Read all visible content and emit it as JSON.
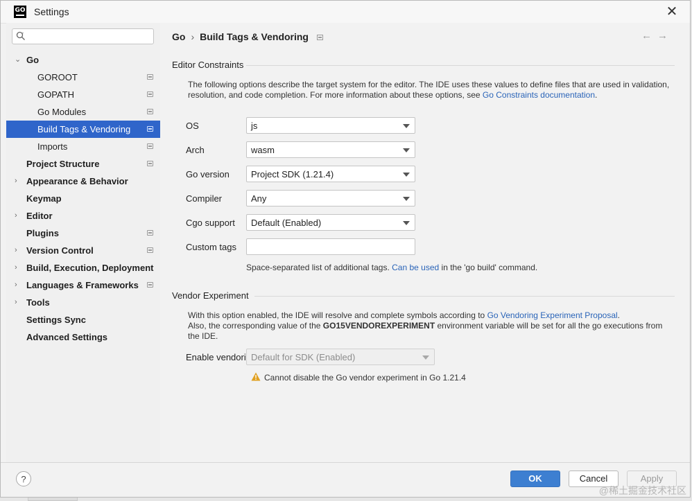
{
  "window": {
    "title": "Settings",
    "app_icon_text": "GO"
  },
  "sidebar": {
    "search_placeholder": "",
    "items": [
      {
        "label": "Go"
      },
      {
        "label": "GOROOT"
      },
      {
        "label": "GOPATH"
      },
      {
        "label": "Go Modules"
      },
      {
        "label": "Build Tags & Vendoring"
      },
      {
        "label": "Imports"
      },
      {
        "label": "Project Structure"
      },
      {
        "label": "Appearance & Behavior"
      },
      {
        "label": "Keymap"
      },
      {
        "label": "Editor"
      },
      {
        "label": "Plugins"
      },
      {
        "label": "Version Control"
      },
      {
        "label": "Build, Execution, Deployment"
      },
      {
        "label": "Languages & Frameworks"
      },
      {
        "label": "Tools"
      },
      {
        "label": "Settings Sync"
      },
      {
        "label": "Advanced Settings"
      }
    ]
  },
  "breadcrumb": {
    "parent": "Go",
    "separator": "›",
    "current": "Build Tags & Vendoring"
  },
  "nav": {
    "back": "←",
    "forward": "→"
  },
  "editor_constraints": {
    "title": "Editor Constraints",
    "desc_text": "The following options describe the target system for the editor. The IDE uses these values to define files that are used in validation, resolution, and code completion. For more information about these options, see ",
    "desc_link": "Go Constraints documentation",
    "desc_end": ".",
    "fields": {
      "os": {
        "label": "OS",
        "value": "js"
      },
      "arch": {
        "label": "Arch",
        "value": "wasm"
      },
      "go_version": {
        "label": "Go version",
        "value": "Project SDK (1.21.4)"
      },
      "compiler": {
        "label": "Compiler",
        "value": "Any"
      },
      "cgo": {
        "label": "Cgo support",
        "value": "Default (Enabled)"
      },
      "custom_tags": {
        "label": "Custom tags",
        "value": ""
      }
    },
    "hint_text": "Space-separated list of additional tags. ",
    "hint_link": "Can be used",
    "hint_end": " in the 'go build' command."
  },
  "vendor": {
    "title": "Vendor Experiment",
    "desc1_text": "With this option enabled, the IDE will resolve and complete symbols according to ",
    "desc1_link": "Go Vendoring Experiment Proposal",
    "desc1_end": ".",
    "desc2_start": "Also, the corresponding value of the ",
    "desc2_bold": "GO15VENDOREXPERIMENT",
    "desc2_end": " environment variable will be set for all the go executions from the IDE.",
    "enable_label": "Enable vendoring",
    "enable_value": "Default for SDK (Enabled)",
    "warning": "Cannot disable the Go vendor experiment in Go 1.21.4"
  },
  "footer": {
    "help": "?",
    "ok": "OK",
    "cancel": "Cancel",
    "apply": "Apply"
  },
  "watermark": "@稀土掘金技术社区",
  "colors": {
    "selection": "#2f65ca",
    "link": "#2a64b8",
    "ok_button": "#3d7fd1",
    "warning": "#e0a020"
  }
}
